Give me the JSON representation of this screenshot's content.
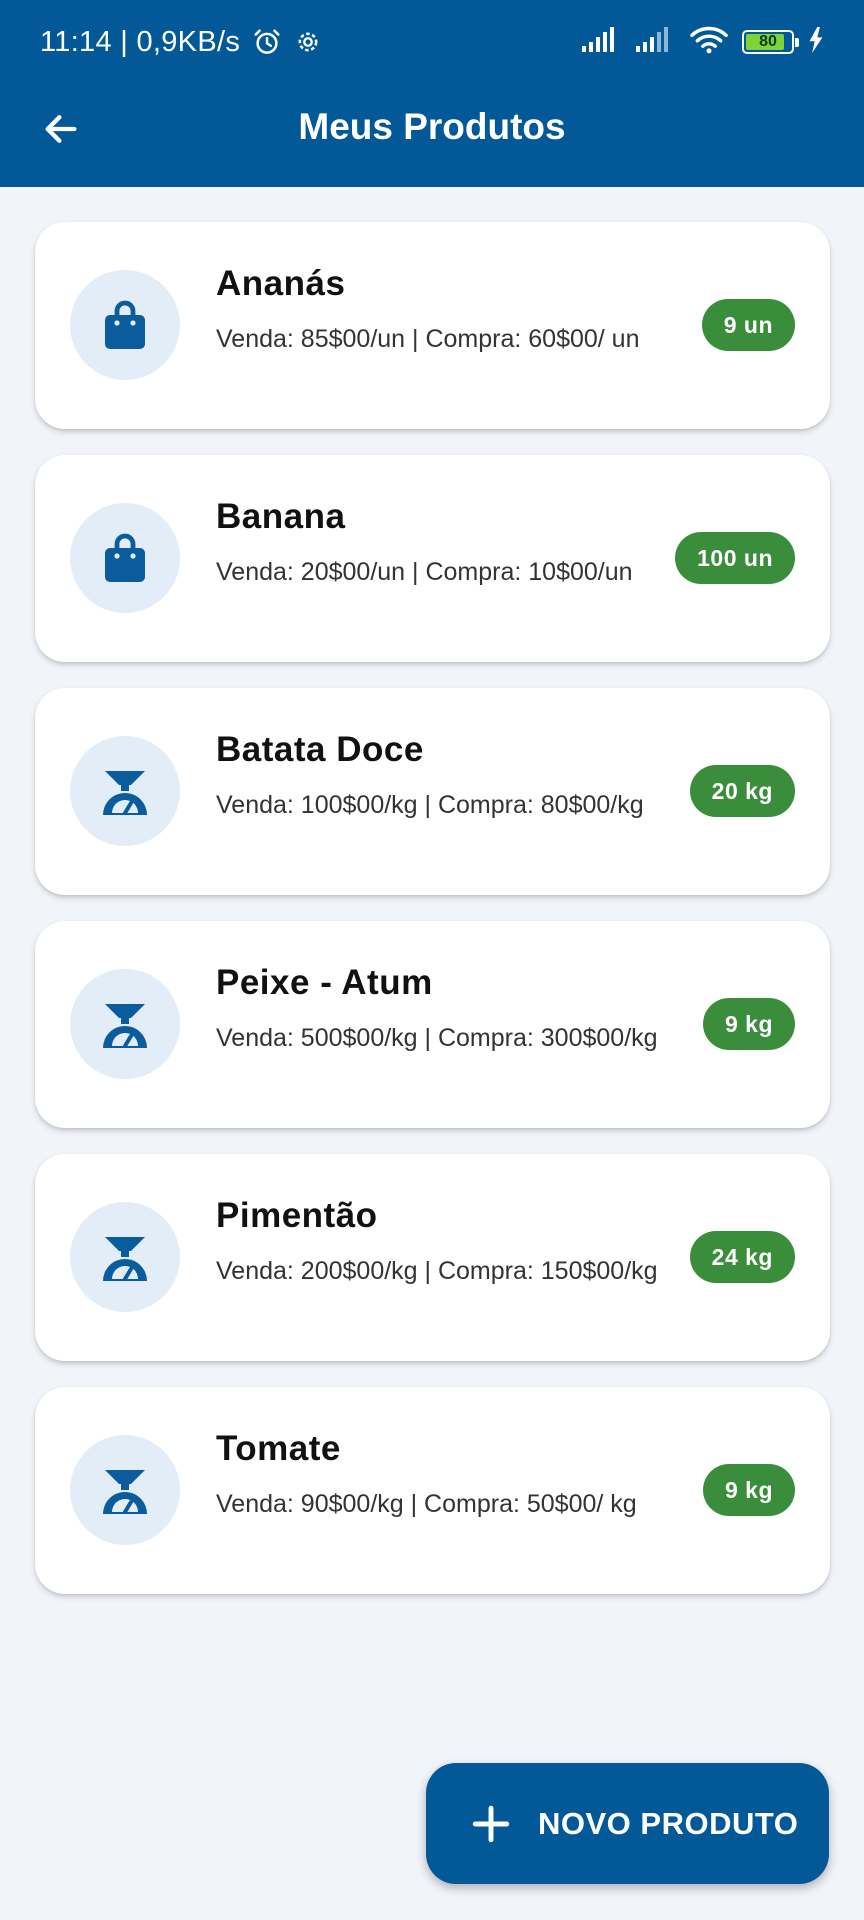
{
  "status_bar": {
    "time_and_speed": "11:14 | 0,9KB/s",
    "battery_level": "80"
  },
  "header": {
    "title": "Meus Produtos"
  },
  "products": [
    {
      "name": "Ananás",
      "price": "Venda: 85$00/un | Compra: 60$00/ un",
      "stock": "9 un",
      "icon": "shopping-bag-icon"
    },
    {
      "name": "Banana",
      "price": "Venda: 20$00/un | Compra: 10$00/un",
      "stock": "100 un",
      "icon": "shopping-bag-icon"
    },
    {
      "name": "Batata Doce",
      "price": "Venda: 100$00/kg | Compra: 80$00/kg",
      "stock": "20 kg",
      "icon": "scale-icon"
    },
    {
      "name": "Peixe - Atum",
      "price": "Venda: 500$00/kg | Compra: 300$00/kg",
      "stock": "9 kg",
      "icon": "scale-icon"
    },
    {
      "name": "Pimentão",
      "price": "Venda: 200$00/kg | Compra: 150$00/kg",
      "stock": "24 kg",
      "icon": "scale-icon"
    },
    {
      "name": "Tomate",
      "price": "Venda: 90$00/kg | Compra: 50$00/ kg",
      "stock": "9 kg",
      "icon": "scale-icon"
    }
  ],
  "fab": {
    "label": "NOVO PRODUTO"
  },
  "colors": {
    "primary": "#035998",
    "badge": "#3a8e3b",
    "avatar_bg": "#e3edf7",
    "background": "#f1f4f8"
  }
}
